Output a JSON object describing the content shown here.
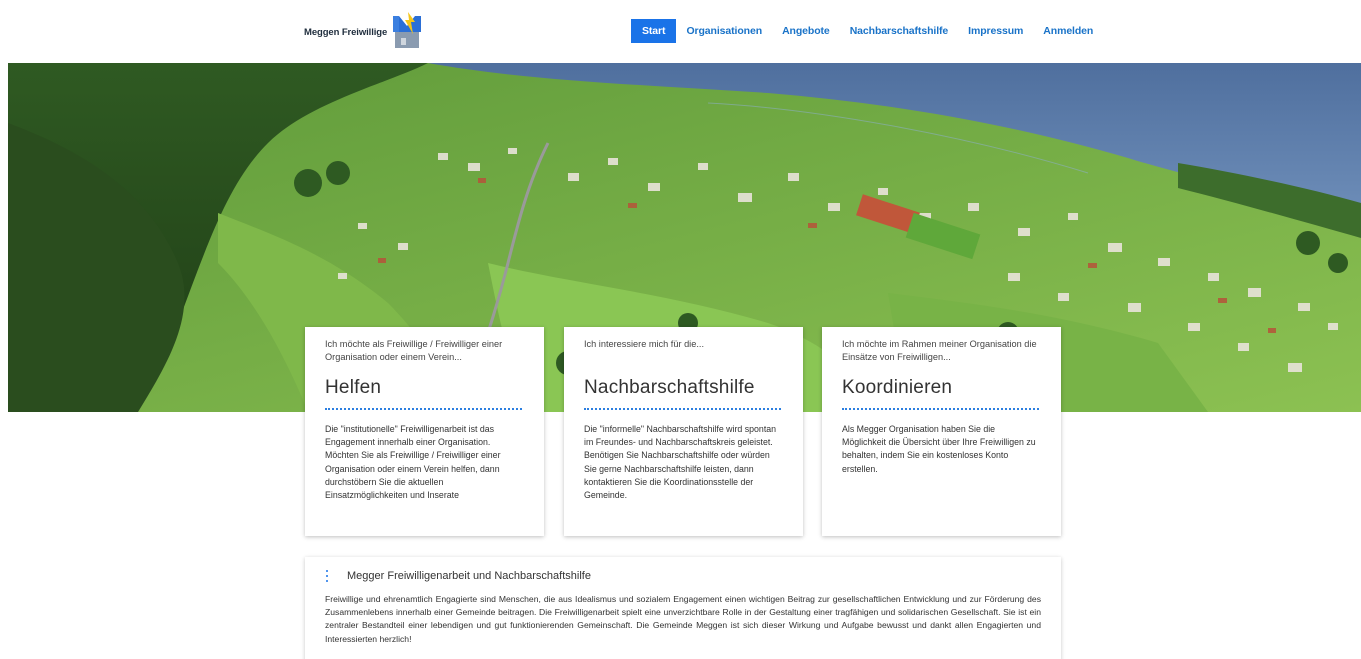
{
  "brand": {
    "name": "Meggen Freiwillige",
    "logo_icon": "meggen-logo-icon"
  },
  "nav": {
    "items": [
      {
        "label": "Start",
        "active": true
      },
      {
        "label": "Organisationen",
        "active": false
      },
      {
        "label": "Angebote",
        "active": false
      },
      {
        "label": "Nachbarschaftshilfe",
        "active": false
      },
      {
        "label": "Impressum",
        "active": false
      },
      {
        "label": "Anmelden",
        "active": false
      }
    ]
  },
  "colors": {
    "accent": "#1a73e8",
    "link": "#1a73c8"
  },
  "cards": [
    {
      "intro": "Ich möchte als Freiwillige / Freiwilliger einer Organisation oder einem Verein...",
      "title": "Helfen",
      "body": "Die \"institutionelle\" Freiwilligenarbeit ist das Engagement innerhalb einer Organisation. Möchten Sie als Freiwillige / Freiwilliger einer Organisation oder einem Verein helfen, dann durchstöbern Sie die aktuellen Einsatzmöglichkeiten und Inserate"
    },
    {
      "intro": "Ich interessiere mich für die...",
      "title": "Nachbarschaftshilfe",
      "body": "Die \"informelle\" Nachbarschaftshilfe wird spontan im Freundes- und Nachbarschaftskreis geleistet. Benötigen Sie Nachbarschaftshilfe oder würden Sie gerne Nachbarschaftshilfe leisten, dann kontaktieren Sie die Koordinationsstelle der Gemeinde."
    },
    {
      "intro": "Ich möchte im Rahmen meiner Organisation die Einsätze von Freiwilligen...",
      "title": "Koordinieren",
      "body": "Als Megger Organisation haben Sie die Möglichkeit die Übersicht über Ihre Freiwilligen zu behalten, indem Sie ein kostenloses Konto erstellen."
    }
  ],
  "info": {
    "title": "Megger Freiwilligenarbeit und Nachbarschaftshilfe",
    "body": "Freiwillige und ehrenamtlich Engagierte sind Menschen, die aus Idealismus und sozialem Engagement einen wichtigen Beitrag zur gesellschaftlichen Entwicklung und zur Förderung des Zusammenlebens innerhalb einer Gemeinde beitragen. Die Freiwilligenarbeit spielt eine unverzichtbare Rolle in der Gestaltung einer tragfähigen und solidarischen Gesellschaft. Sie ist ein zentraler Bestandteil einer lebendigen und gut funktionierenden Gemeinschaft. Die Gemeinde Meggen ist sich dieser Wirkung und Aufgabe bewusst und dankt allen Engagierten und Interessierten herzlich!"
  }
}
